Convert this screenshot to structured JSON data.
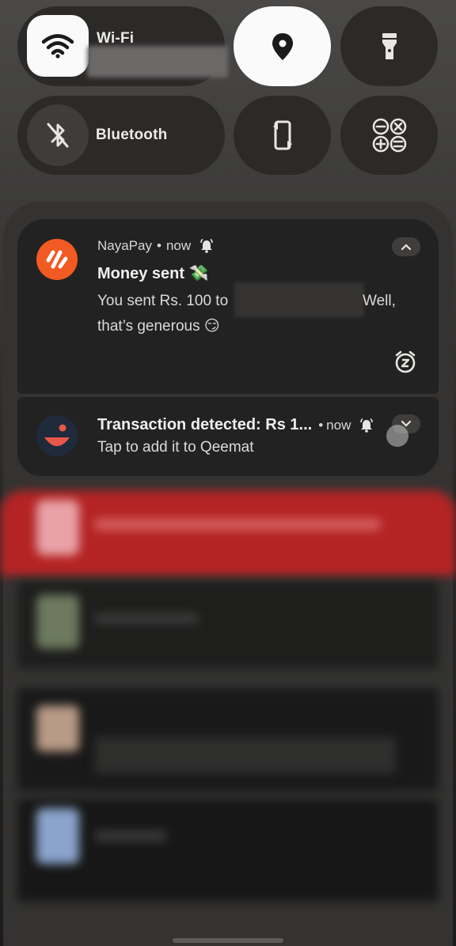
{
  "quick_settings": {
    "wifi": {
      "label": "Wi-Fi",
      "icon": "wifi-icon"
    },
    "location": {
      "icon": "location-pin-icon"
    },
    "flashlight": {
      "icon": "flashlight-icon"
    },
    "bluetooth": {
      "label": "Bluetooth",
      "icon": "bluetooth-off-icon"
    },
    "auto_rotate": {
      "icon": "auto-rotate-icon"
    },
    "calculator": {
      "icon": "calculator-icon"
    }
  },
  "notifications": [
    {
      "app": "NayaPay",
      "separator": "•",
      "time": "now",
      "title": "Money sent 💸",
      "body_start": "You sent Rs. 100 to",
      "body_end": "Well,",
      "body_line2": "that’s generous 😏",
      "accent": "#f15a22"
    },
    {
      "title": "Transaction detected: Rs 1...",
      "separator": "•",
      "time": "now",
      "body": "Tap to add it to Qeemat",
      "accent": "#e8574a"
    }
  ]
}
